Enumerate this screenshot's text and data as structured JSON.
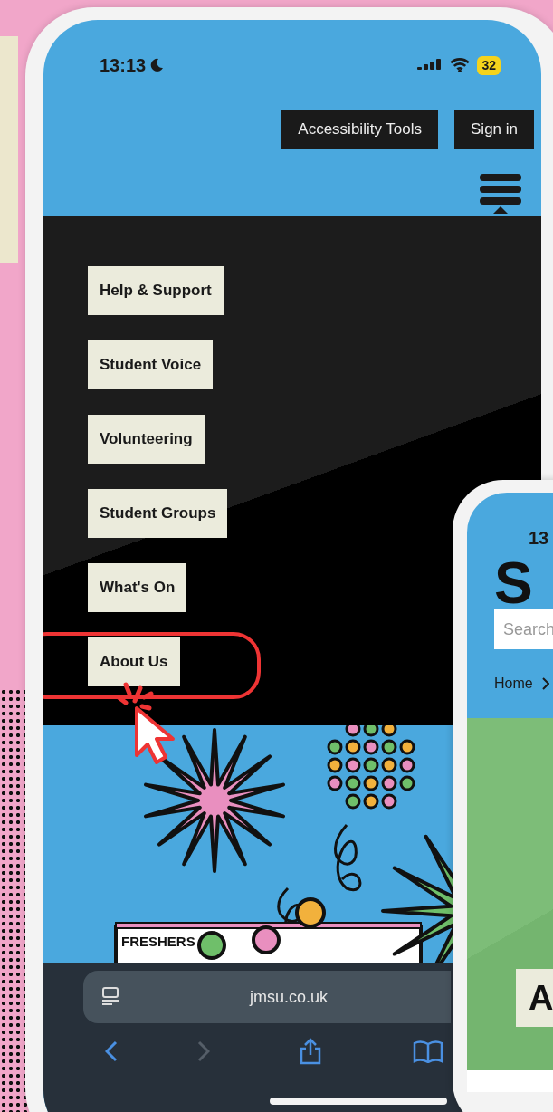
{
  "status_bar": {
    "time": "13:13",
    "battery": "32"
  },
  "header": {
    "buttons": [
      "Accessibility Tools",
      "Sign in"
    ]
  },
  "menu": {
    "items": [
      {
        "label": "Help & Support",
        "highlighted": false
      },
      {
        "label": "Student Voice",
        "highlighted": false
      },
      {
        "label": "Volunteering",
        "highlighted": false
      },
      {
        "label": "Student Groups",
        "highlighted": false
      },
      {
        "label": "What's On",
        "highlighted": false
      },
      {
        "label": "About Us",
        "highlighted": true
      }
    ]
  },
  "illustration": {
    "banner_text": "FRESHERS"
  },
  "browser": {
    "url": "jmsu.co.uk"
  },
  "second_phone": {
    "time": "13",
    "logo": "S",
    "search": {
      "placeholder": "Search"
    },
    "breadcrumb": "Home",
    "button": "A"
  }
}
